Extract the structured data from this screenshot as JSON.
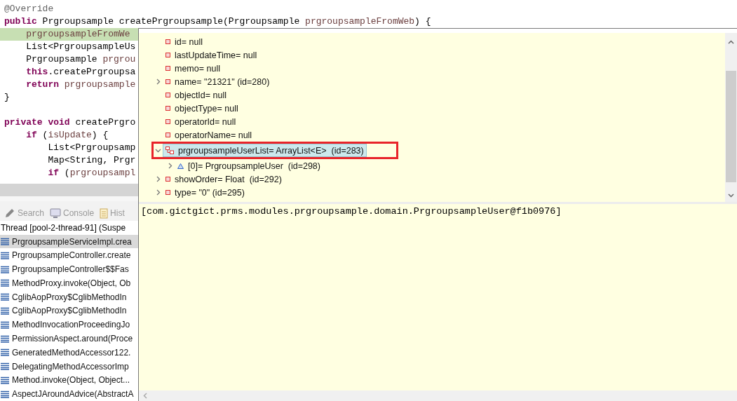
{
  "editor": {
    "lines": [
      {
        "highlighted": false,
        "tokens": [
          {
            "kind": "annotation",
            "text": "@Override"
          }
        ]
      },
      {
        "highlighted": false,
        "tokens": [
          {
            "kind": "keyword",
            "text": "public"
          },
          {
            "kind": "plain",
            "text": " Prgroupsample createPrgroupsample(Prgroupsample "
          },
          {
            "kind": "param",
            "text": "prgroupsampleFromWeb"
          },
          {
            "kind": "plain",
            "text": ") {"
          }
        ]
      },
      {
        "highlighted": true,
        "tokens": [
          {
            "kind": "param",
            "text": "    prgroupsampleFromWe"
          }
        ]
      },
      {
        "highlighted": false,
        "tokens": [
          {
            "kind": "plain",
            "text": "    List<PrgroupsampleUs"
          }
        ]
      },
      {
        "highlighted": false,
        "tokens": [
          {
            "kind": "plain",
            "text": "    Prgroupsample "
          },
          {
            "kind": "param",
            "text": "prgrou"
          }
        ]
      },
      {
        "highlighted": false,
        "tokens": [
          {
            "kind": "keyword",
            "text": "    this"
          },
          {
            "kind": "plain",
            "text": ".createPrgroupsa"
          }
        ]
      },
      {
        "highlighted": false,
        "tokens": [
          {
            "kind": "keyword",
            "text": "    return"
          },
          {
            "kind": "param",
            "text": " prgroupsample"
          }
        ]
      },
      {
        "highlighted": false,
        "tokens": [
          {
            "kind": "plain",
            "text": "}"
          }
        ]
      },
      {
        "highlighted": false
      },
      {
        "highlighted": false,
        "tokens": [
          {
            "kind": "keyword",
            "text": "private void"
          },
          {
            "kind": "plain",
            "text": " createPrgro"
          }
        ]
      },
      {
        "highlighted": false,
        "tokens": [
          {
            "kind": "keyword",
            "text": "    if"
          },
          {
            "kind": "plain",
            "text": " ("
          },
          {
            "kind": "param",
            "text": "isUpdate"
          },
          {
            "kind": "plain",
            "text": ") {"
          }
        ]
      },
      {
        "highlighted": false,
        "tokens": [
          {
            "kind": "plain",
            "text": "        List<Prgroupsamp"
          }
        ]
      },
      {
        "highlighted": false,
        "tokens": [
          {
            "kind": "plain",
            "text": "        Map<String, Prgr"
          }
        ]
      },
      {
        "highlighted": false,
        "tokens": [
          {
            "kind": "keyword",
            "text": "        if"
          },
          {
            "kind": "plain",
            "text": " ("
          },
          {
            "kind": "param",
            "text": "prgroupsampl"
          }
        ]
      }
    ]
  },
  "view_tabs": [
    {
      "label": "Search"
    },
    {
      "label": "Console"
    },
    {
      "label": "Hist"
    }
  ],
  "debug": {
    "thread": "Thread [pool-2-thread-91] (Suspe",
    "frames": [
      {
        "label": "PrgroupsampleServiceImpl.crea",
        "selected": true
      },
      {
        "label": "PrgroupsampleController.create",
        "selected": false
      },
      {
        "label": "PrgroupsampleController$$Fas",
        "selected": false
      },
      {
        "label": "MethodProxy.invoke(Object, Ob",
        "selected": false
      },
      {
        "label": "CglibAopProxy$CglibMethodIn",
        "selected": false
      },
      {
        "label": "CglibAopProxy$CglibMethodIn",
        "selected": false
      },
      {
        "label": "MethodInvocationProceedingJo",
        "selected": false
      },
      {
        "label": "PermissionAspect.around(Proce",
        "selected": false
      },
      {
        "label": "GeneratedMethodAccessor122.",
        "selected": false
      },
      {
        "label": "DelegatingMethodAccessorImp",
        "selected": false
      },
      {
        "label": "Method.invoke(Object, Object...",
        "selected": false
      },
      {
        "label": "AspectJAroundAdvice(AbstractA",
        "selected": false
      }
    ]
  },
  "inspector": {
    "variables": [
      {
        "kind": "field",
        "label": "id= null",
        "expandable": false,
        "selected": false
      },
      {
        "kind": "field",
        "label": "lastUpdateTime= null",
        "expandable": false,
        "selected": false
      },
      {
        "kind": "field",
        "label": "memo= null",
        "expandable": false,
        "selected": false
      },
      {
        "kind": "field",
        "label": "name= \"21321\" (id=280)",
        "expandable": true,
        "expanded": false,
        "selected": false
      },
      {
        "kind": "field",
        "label": "objectId= null",
        "expandable": false,
        "selected": false
      },
      {
        "kind": "field",
        "label": "objectType= null",
        "expandable": false,
        "selected": false
      },
      {
        "kind": "field",
        "label": "operatorId= null",
        "expandable": false,
        "selected": false
      },
      {
        "kind": "field",
        "label": "operatorName= null",
        "expandable": false,
        "selected": false
      },
      {
        "kind": "list",
        "label": "prgroupsampleUserList= ArrayList<E>  (id=283)",
        "expandable": true,
        "expanded": true,
        "selected": true,
        "children": [
          {
            "kind": "element",
            "label": "[0]= PrgroupsampleUser  (id=298)",
            "expandable": true,
            "expanded": false,
            "selected": false
          }
        ]
      },
      {
        "kind": "field",
        "label": "showOrder= Float  (id=292)",
        "expandable": true,
        "expanded": false,
        "selected": false
      },
      {
        "kind": "field",
        "label": "type= \"0\" (id=295)",
        "expandable": true,
        "expanded": false,
        "selected": false
      }
    ],
    "detail": "[com.gictgict.prms.modules.prgroupsample.domain.PrgroupsampleUser@f1b0976]"
  }
}
